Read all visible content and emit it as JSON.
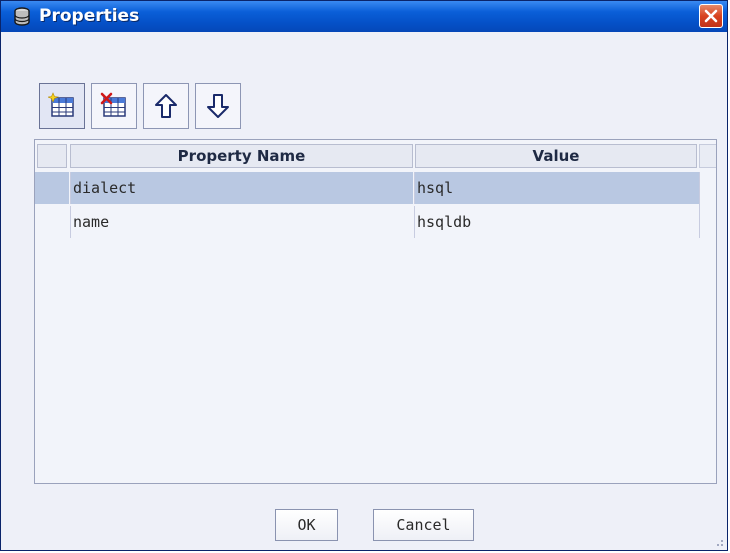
{
  "window": {
    "title": "Properties",
    "app_icon": "database-icon",
    "close_icon": "close-icon"
  },
  "toolbar": {
    "buttons": [
      {
        "name": "add-property-button",
        "icon": "add-row-icon",
        "pressed": true
      },
      {
        "name": "remove-property-button",
        "icon": "delete-row-icon",
        "pressed": false
      },
      {
        "name": "move-up-button",
        "icon": "arrow-up-icon",
        "pressed": false
      },
      {
        "name": "move-down-button",
        "icon": "arrow-down-icon",
        "pressed": false
      }
    ]
  },
  "table": {
    "columns": [
      "Property Name",
      "Value"
    ],
    "rows": [
      {
        "name": "dialect",
        "value": "hsql",
        "selected": true
      },
      {
        "name": "name",
        "value": "hsqldb",
        "selected": false
      }
    ]
  },
  "dialog_buttons": {
    "ok_label": "OK",
    "cancel_label": "Cancel"
  },
  "colors": {
    "title_bar": "#0a5fd8",
    "selection": "#b9c8e2",
    "close_button": "#d8431f"
  }
}
